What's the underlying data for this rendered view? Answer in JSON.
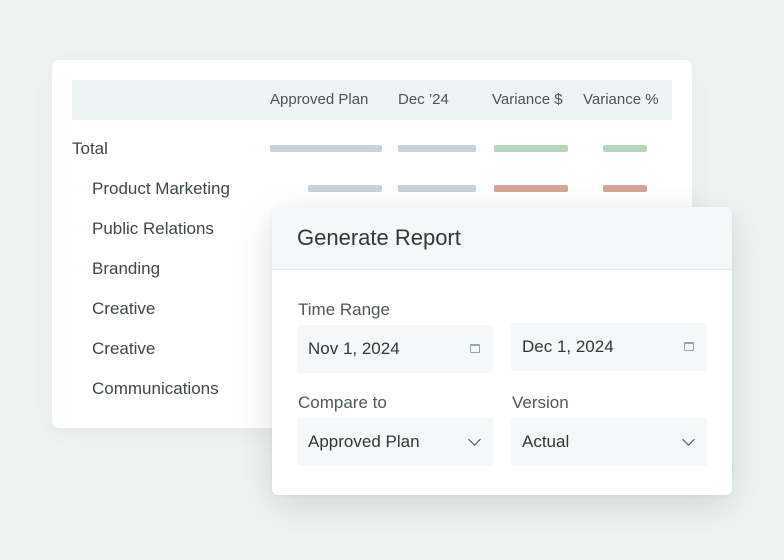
{
  "table": {
    "columns": [
      "Approved Plan",
      "Dec ’24",
      "Variance $",
      "Variance %"
    ],
    "rows": [
      {
        "label": "Total",
        "variance_sign": "positive"
      },
      {
        "label": "Product Marketing",
        "variance_sign": "negative"
      },
      {
        "label": "Public Relations"
      },
      {
        "label": "Branding"
      },
      {
        "label": "Creative"
      },
      {
        "label": "Creative"
      },
      {
        "label": "Communications"
      }
    ],
    "colors": {
      "placeholder_bar": "#c4d4d9",
      "positive": "#b5d6bc",
      "negative": "#d4a796"
    }
  },
  "dialog": {
    "title": "Generate Report",
    "time_range": {
      "label": "Time Range",
      "start": "Nov 1, 2024",
      "end": "Dec 1, 2024",
      "icon": "calendar-icon"
    },
    "compare_to": {
      "label": "Compare to",
      "value": "Approved Plan",
      "icon": "chevron-down-icon"
    },
    "version": {
      "label": "Version",
      "value": "Actual",
      "icon": "chevron-down-icon"
    }
  }
}
